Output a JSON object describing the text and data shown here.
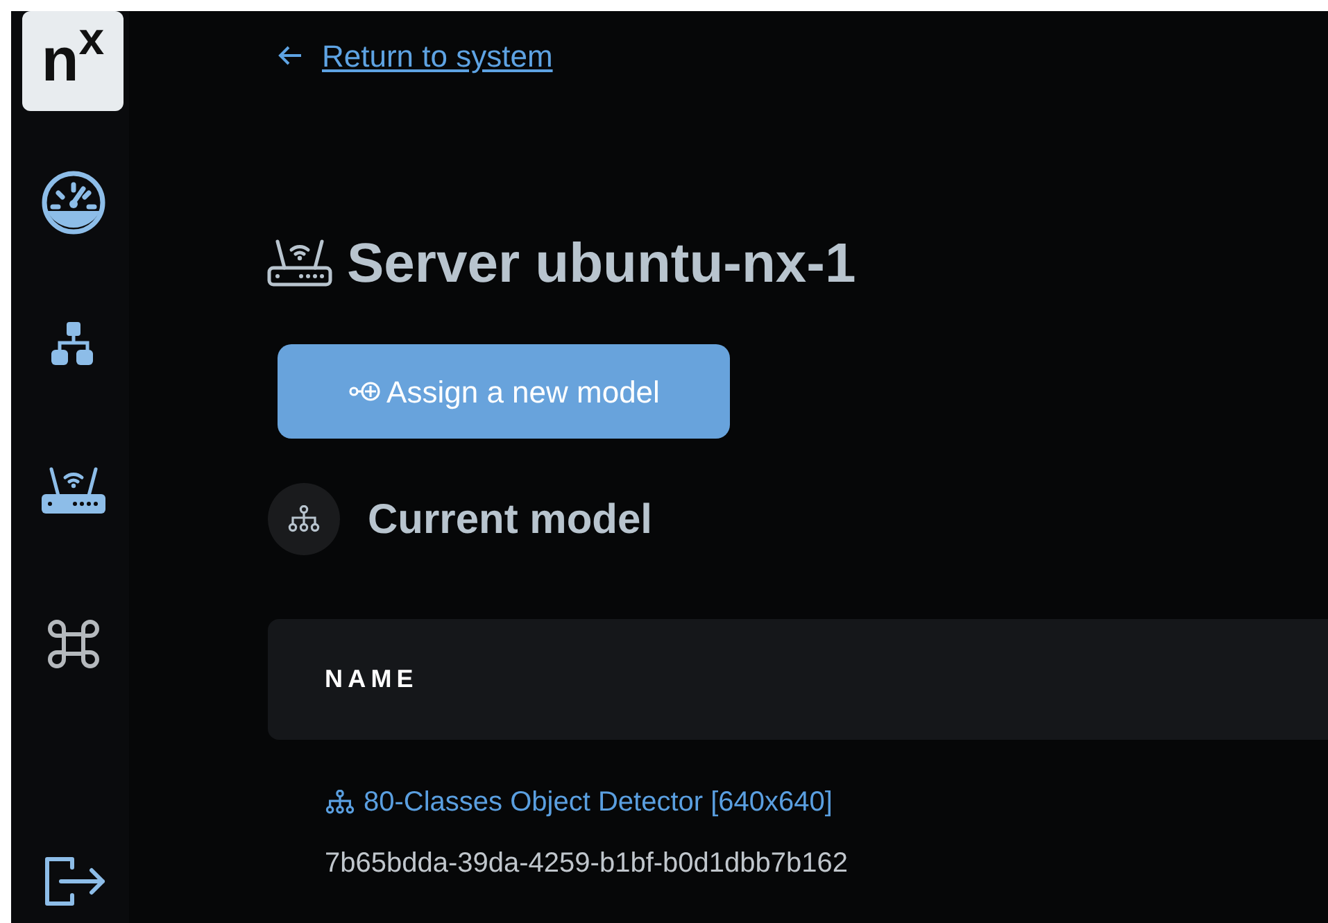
{
  "logo": {
    "text": "n$^{x}$"
  },
  "back_link": {
    "label": "Return to system"
  },
  "page_title": "Server ubuntu-nx-1",
  "assign_button": {
    "label": "Assign a new model"
  },
  "section": {
    "title": "Current model"
  },
  "table": {
    "columns": [
      "NAME"
    ],
    "rows": [
      {
        "name": "80-Classes Object Detector [640x640]",
        "id": "7b65bdda-39da-4259-b1bf-b0d1dbb7b162"
      }
    ]
  }
}
